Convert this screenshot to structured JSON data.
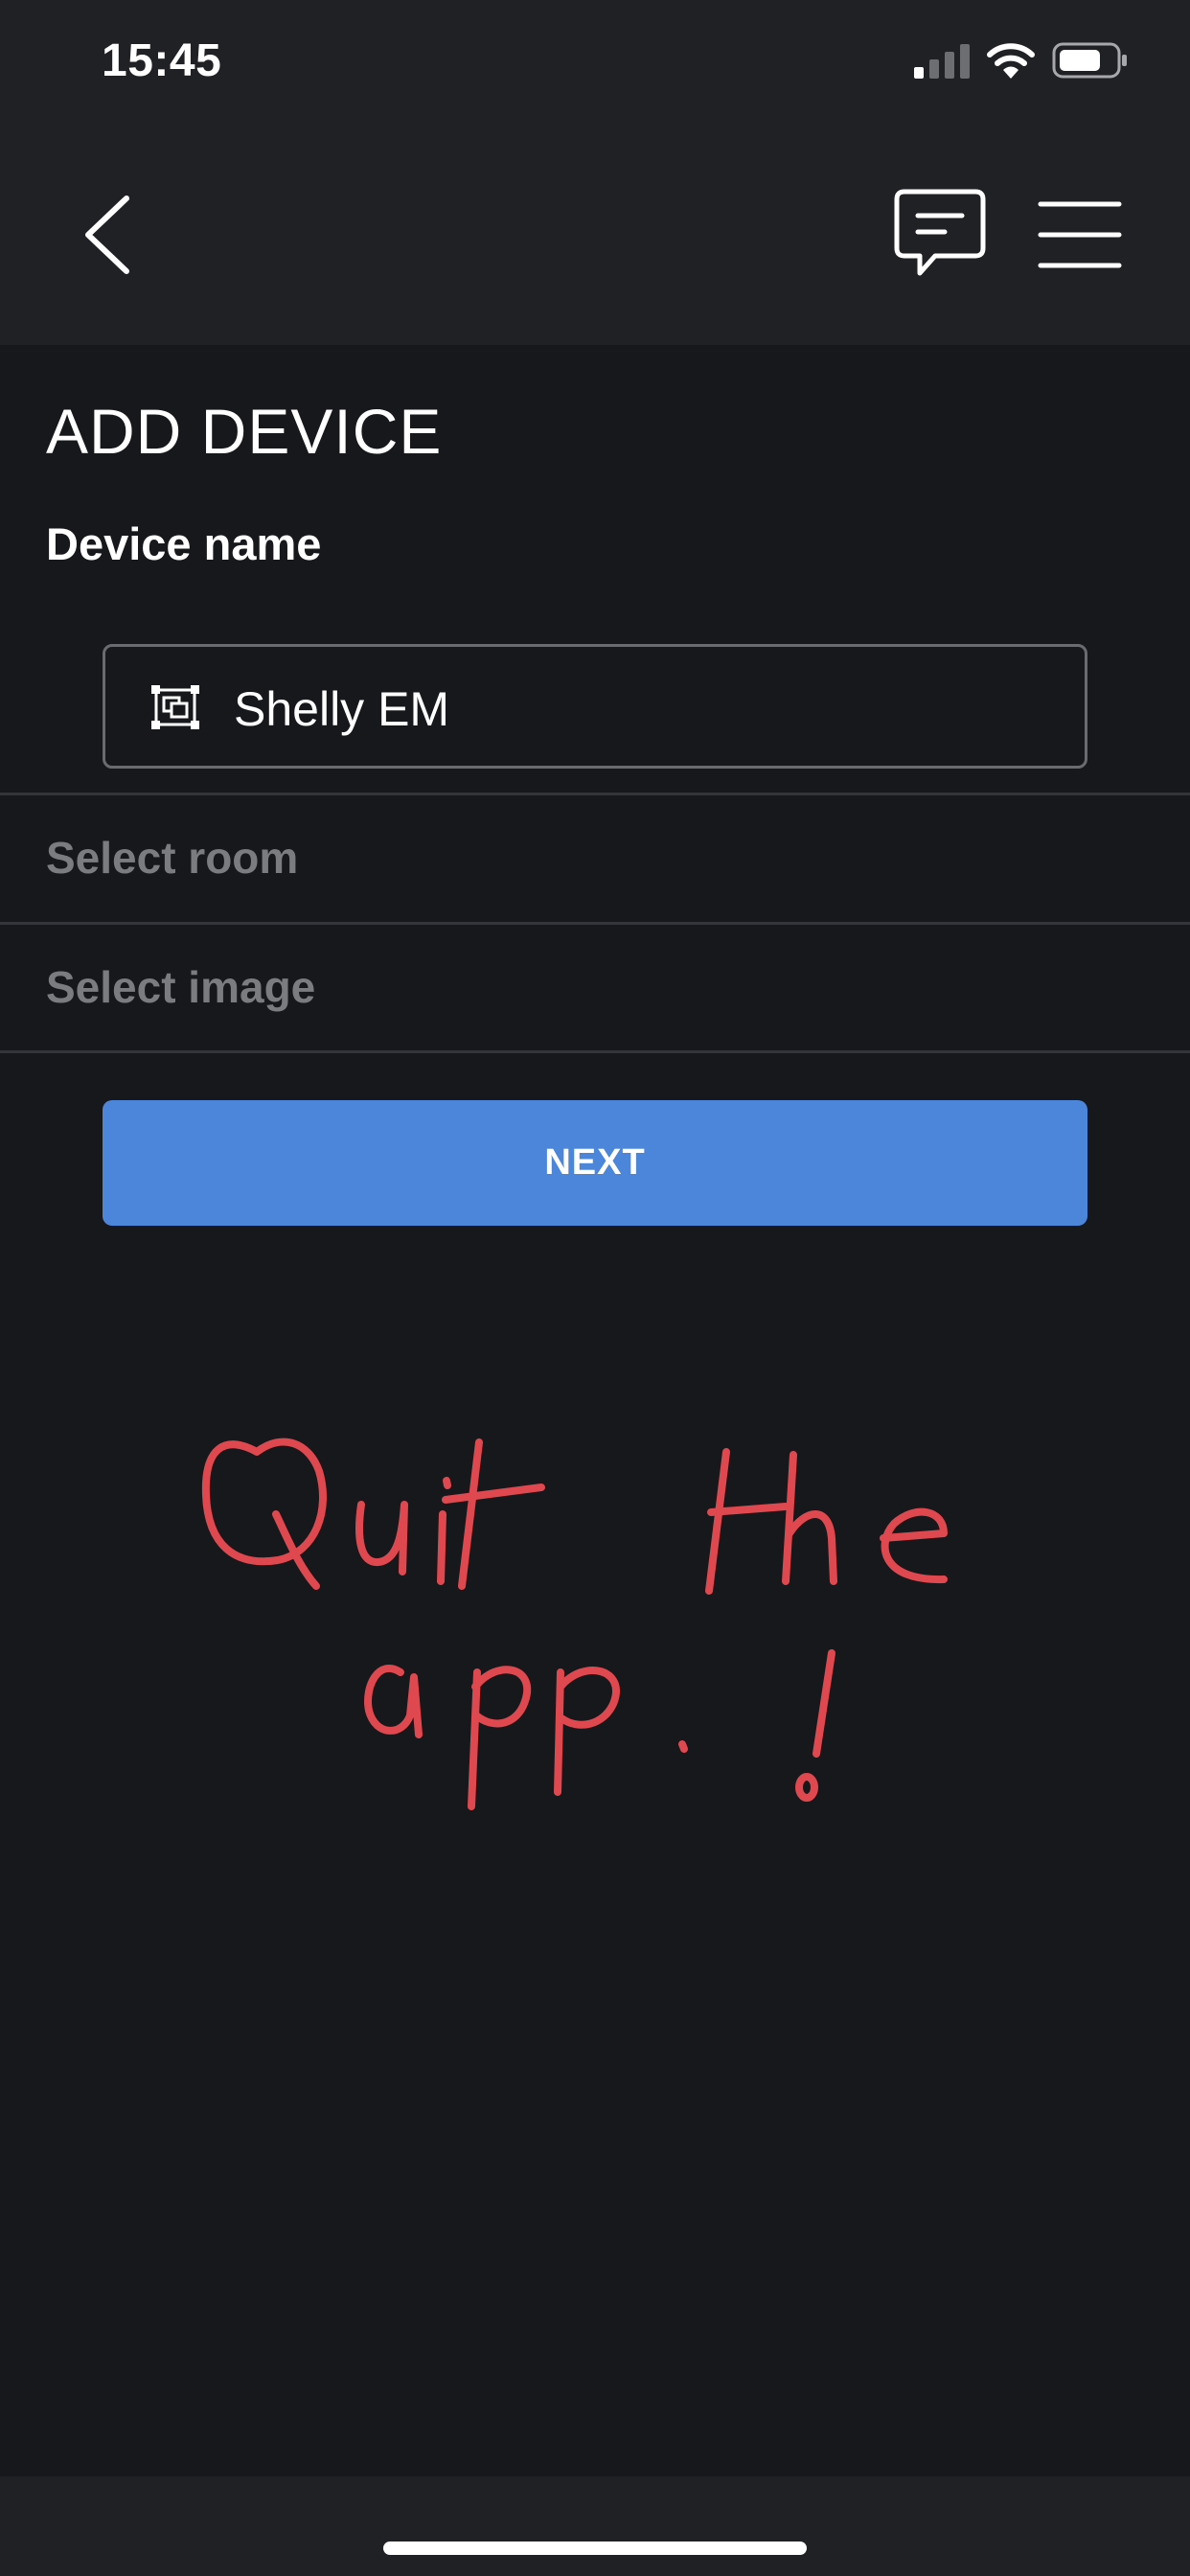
{
  "status_bar": {
    "time": "15:45",
    "icons": [
      "signal-icon",
      "wifi-icon",
      "battery-icon"
    ]
  },
  "nav": {
    "back_icon": "chevron-left-icon",
    "chat_icon": "chat-bubble-icon",
    "menu_icon": "hamburger-menu-icon"
  },
  "page": {
    "title": "ADD DEVICE",
    "device_name_label": "Device name",
    "device_name_value": "Shelly EM",
    "device_name_icon": "device-frame-icon",
    "select_room_label": "Select room",
    "select_image_label": "Select image",
    "next_label": "NEXT"
  },
  "annotation": {
    "line1": "Quit the",
    "line2": "app. !",
    "color": "#e0484f"
  },
  "colors": {
    "background": "#17181b",
    "panel": "#202125",
    "accent": "#4b86db",
    "muted_text": "#7b7c80",
    "divider": "#34353a"
  }
}
